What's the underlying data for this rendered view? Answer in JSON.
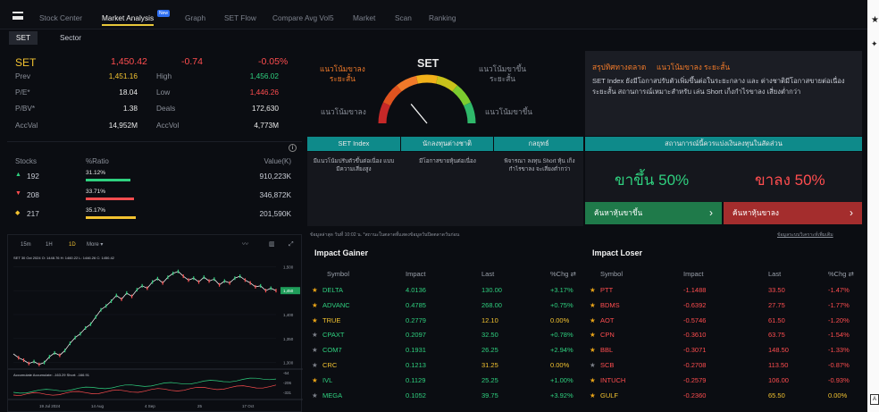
{
  "nav": {
    "menu": "menu",
    "tabs": [
      "Stock Center",
      "Market Analysis",
      "Graph",
      "SET Flow",
      "Compare Avg Vol5",
      "Market",
      "Scan",
      "Ranking"
    ],
    "new_badge": "New"
  },
  "subtabs": [
    "SET",
    "Sector"
  ],
  "index": {
    "name": "SET",
    "value": "1,450.42",
    "change": "-0.74",
    "pct": "-0.05%",
    "stats": [
      [
        "Prev",
        "1,451.16",
        "High",
        "1,456.02"
      ],
      [
        "P/E*",
        "18.04",
        "Low",
        "1,446.26"
      ],
      [
        "P/BV*",
        "1.38",
        "Deals",
        "172,630"
      ],
      [
        "AccVal",
        "14,952M",
        "AccVol",
        "4,773M"
      ]
    ]
  },
  "breadth": {
    "headers": [
      "Stocks",
      "%Ratio",
      "Value(K)"
    ],
    "rows": [
      {
        "arrow": "▲",
        "count": "192",
        "ratio": "31.12%",
        "value": "910,223K",
        "pct": 31.12,
        "color": "#2fd07f"
      },
      {
        "arrow": "▼",
        "count": "208",
        "ratio": "33.71%",
        "value": "346,872K",
        "pct": 33.71,
        "color": "#ff4d4f"
      },
      {
        "arrow": "◆",
        "count": "217",
        "ratio": "35.17%",
        "value": "201,590K",
        "pct": 35.17,
        "color": "#f2c230"
      }
    ]
  },
  "chart": {
    "periods": [
      "15m",
      "1H",
      "1D",
      "More"
    ],
    "info": "SET  30 Oct 2024   O: 1448.76   H: 1460.22   L: 1446.26   C: 1450.42",
    "yticks": [
      "1,500",
      "1,450",
      "1,400",
      "1,350",
      "1,300"
    ],
    "current": "1,450",
    "indicator": "Accumulate   Accumulate: -163.29   Short: -166.91",
    "indticks": [
      "-64",
      "-206",
      "-331"
    ],
    "xticks": [
      "19 Jul 2024",
      "14 Aug",
      "4 Sep",
      "25",
      "17 Oct"
    ],
    "chart_data": {
      "type": "line",
      "ylim": [
        1290,
        1510
      ],
      "price": [
        1318,
        1310,
        1305,
        1298,
        1302,
        1296,
        1300,
        1312,
        1320,
        1315,
        1325,
        1340,
        1352,
        1360,
        1372,
        1380,
        1395,
        1410,
        1418,
        1428,
        1440,
        1432,
        1445,
        1438,
        1452,
        1460,
        1455,
        1468,
        1475,
        1466,
        1478,
        1486,
        1490,
        1480,
        1472,
        1476,
        1468,
        1478,
        1470,
        1474,
        1462,
        1470,
        1466,
        1476,
        1480,
        1472,
        1466,
        1458,
        1460,
        1450,
        1455,
        1450
      ]
    }
  },
  "gauge": {
    "title": "SET",
    "left_top": "แนวโน้มขาลง\nระยะสั้น",
    "right_top": "แนวโน้มขาขึ้น\nระยะสั้น",
    "left_bottom": "แนวโน้มขาลง",
    "right_bottom": "แนวโน้มขาขึ้น",
    "level": 0.28
  },
  "summary": {
    "title": "สรุปทิศทางตลาด",
    "highlight": "แนวโน้มขาลง ระยะสั้น",
    "body": "SET Index ยังมีโอกาสปรับตัวเพิ่มขึ้นต่อในระยะกลาง และ ต่างชาติมีโอกาสขายต่อเนื่องระยะสั้น สถานการณ์เหมาะสำหรับ เล่น Short เก็งกำไรขาลง เสี่ยงต่ำกว่า"
  },
  "views": {
    "headers": [
      "SET Index",
      "นักลงทุนต่างชาติ",
      "กลยุทธ์"
    ],
    "cells": [
      "มีแนวโน้มปรับตัวขึ้นต่อเนื่อง แบบมีความเสี่ยงสูง",
      "มีโอกาสขายหุ้นต่อเนื่อง",
      "พิจารณา ลงทุน Short หุ้น เก็งกำไรขาลง จะเสี่ยงต่ำกว่า"
    ],
    "situation_header": "สถานการณ์นี้ควรแบ่งเงินลงทุนในสัดส่วน",
    "up": "ขาขึ้น 50%",
    "down": "ขาลง 50%",
    "up_btn": "ค้นหาหุ้นขาขึ้น",
    "down_btn": "ค้นหาหุ้นขาลง",
    "footnote": "ข้อมูลล่าสุด วันที่ 10:02 น. *สถานะในตลาดที่แสดงข้อมูลวันปิดตลาดวันก่อน",
    "link": "ข้อมูลระบบวิเคราะห์เพิ่มเติม"
  },
  "gainer": {
    "title": "Impact Gainer",
    "headers": [
      "Symbol",
      "Impact",
      "Last",
      "%Chg"
    ],
    "rows": [
      [
        "DELTA",
        "4.0136",
        "130.00",
        "+3.17%",
        "g",
        "g"
      ],
      [
        "ADVANC",
        "0.4785",
        "268.00",
        "+0.75%",
        "g",
        "g"
      ],
      [
        "TRUE",
        "0.2779",
        "12.10",
        "0.00%",
        "y",
        "g"
      ],
      [
        "CPAXT",
        "0.2097",
        "32.50",
        "+0.78%",
        "g",
        "a"
      ],
      [
        "COM7",
        "0.1931",
        "26.25",
        "+2.94%",
        "g",
        "a"
      ],
      [
        "CRC",
        "0.1213",
        "31.25",
        "0.00%",
        "y",
        "a"
      ],
      [
        "IVL",
        "0.1129",
        "25.25",
        "+1.00%",
        "g",
        "g"
      ],
      [
        "MEGA",
        "0.1052",
        "39.75",
        "+3.92%",
        "g",
        "a"
      ]
    ]
  },
  "loser": {
    "title": "Impact Loser",
    "headers": [
      "Symbol",
      "Impact",
      "Last",
      "%Chg"
    ],
    "rows": [
      [
        "PTT",
        "-1.1488",
        "33.50",
        "-1.47%",
        "r",
        "g"
      ],
      [
        "BDMS",
        "-0.6392",
        "27.75",
        "-1.77%",
        "r",
        "g"
      ],
      [
        "AOT",
        "-0.5746",
        "61.50",
        "-1.20%",
        "r",
        "g"
      ],
      [
        "CPN",
        "-0.3610",
        "63.75",
        "-1.54%",
        "r",
        "g"
      ],
      [
        "BBL",
        "-0.3071",
        "148.50",
        "-1.33%",
        "r",
        "g"
      ],
      [
        "SCB",
        "-0.2708",
        "113.50",
        "-0.87%",
        "r",
        "a"
      ],
      [
        "INTUCH",
        "-0.2579",
        "106.00",
        "-0.93%",
        "r",
        "g"
      ],
      [
        "GULF",
        "-0.2360",
        "65.50",
        "0.00%",
        "y",
        "g"
      ]
    ]
  }
}
